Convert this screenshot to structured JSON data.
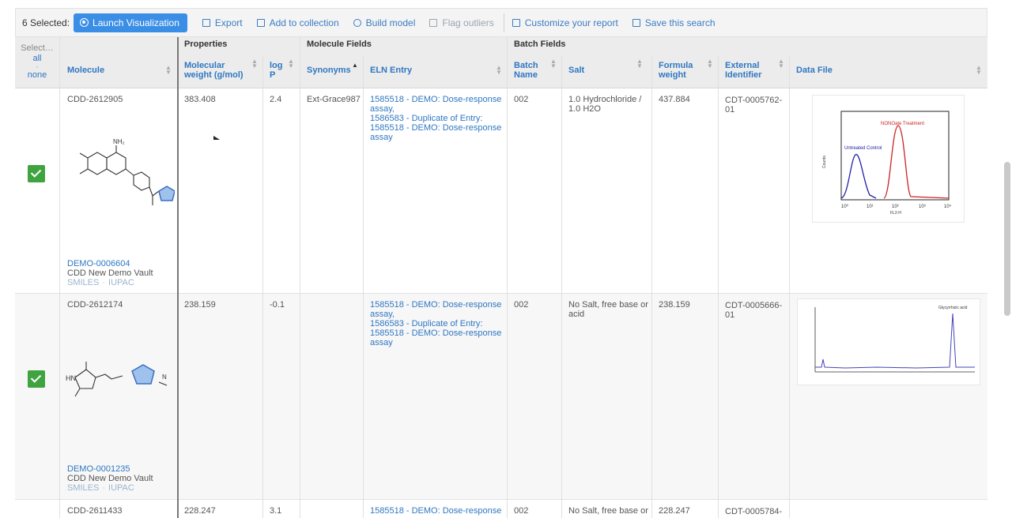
{
  "toolbar": {
    "selected": "6 Selected:",
    "launch": "Launch Visualization",
    "export": "Export",
    "add_collection": "Add to collection",
    "build_model": "Build model",
    "flag_outliers": "Flag outliers",
    "customize": "Customize your report",
    "save_search": "Save this search"
  },
  "select": {
    "label": "Select…",
    "all": "all",
    "none": "none"
  },
  "groups": {
    "properties": "Properties",
    "molecule_fields": "Molecule Fields",
    "batch_fields": "Batch Fields"
  },
  "columns": {
    "molecule": "Molecule",
    "mw": "Molecular weight (g/mol)",
    "logp": "log P",
    "synonyms": "Synonyms",
    "eln": "ELN Entry",
    "batch": "Batch Name",
    "salt": "Salt",
    "formula": "Formula weight",
    "extid": "External Identifier",
    "datafile": "Data File"
  },
  "rows": [
    {
      "cdd": "CDD-2612905",
      "mw": "383.408",
      "logp": "2.4",
      "synonyms": "Ext-Grace987",
      "eln": [
        "1585518 - DEMO: Dose-response assay,",
        "1586583 - Duplicate of Entry:",
        "1585518 - DEMO: Dose-response assay"
      ],
      "batch": "002",
      "salt": "1.0 Hydrochloride / 1.0 H2O",
      "formula": "437.884",
      "extid": "CDT-0005762-01",
      "demo": "DEMO-0006604",
      "vault": "CDD New Demo Vault",
      "smiles": "SMILES",
      "iupac": "IUPAC"
    },
    {
      "cdd": "CDD-2612174",
      "mw": "238.159",
      "logp": "-0.1",
      "synonyms": "",
      "eln": [
        "1585518 - DEMO: Dose-response assay,",
        "1586583 - Duplicate of Entry:",
        "1585518 - DEMO: Dose-response assay"
      ],
      "batch": "002",
      "salt": "No Salt, free base or acid",
      "formula": "238.159",
      "extid": "CDT-0005666-01",
      "demo": "DEMO-0001235",
      "vault": "CDD New Demo Vault",
      "smiles": "SMILES",
      "iupac": "IUPAC"
    },
    {
      "cdd": "CDD-2611433",
      "mw": "228.247",
      "logp": "3.1",
      "eln": [
        "1585518 - DEMO: Dose-response"
      ],
      "batch": "002",
      "salt": "No Salt, free base or",
      "formula": "228.247",
      "extid": "CDT-0005784-"
    }
  ],
  "plot1": {
    "label_left": "Untreated Control",
    "label_right": "NONOate Treatment",
    "ylabel": "Counts",
    "xlabel": "FL2-H",
    "xticks": [
      "10⁰",
      "10¹",
      "10²",
      "10³",
      "10⁴"
    ]
  },
  "plot2": {
    "label": "Glycyrrhizic acid"
  },
  "colors": {
    "link": "#2f77c2",
    "launch": "#3b8ee6",
    "check": "#3fa33f"
  }
}
